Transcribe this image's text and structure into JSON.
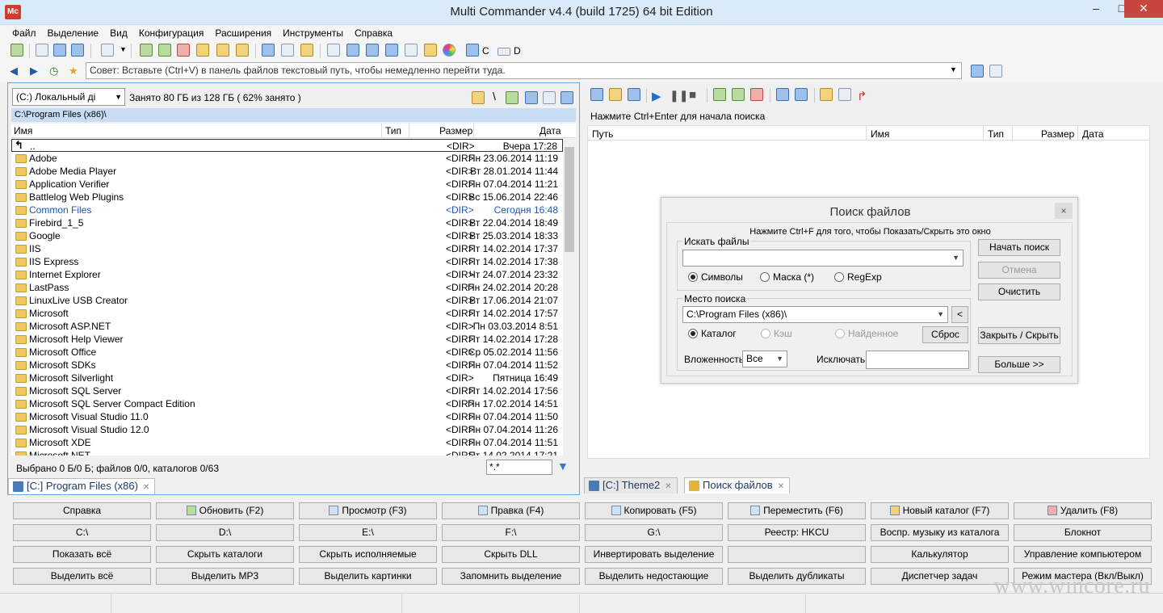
{
  "window": {
    "title": "Multi Commander v4.4 (build 1725) 64 bit Edition",
    "app_icon": "mc-logo-icon",
    "controls": [
      "–",
      "□",
      "✕"
    ]
  },
  "menu": [
    "Файл",
    "Выделение",
    "Вид",
    "Конфигурация",
    "Расширения",
    "Инструменты",
    "Справка"
  ],
  "toolbar": {
    "drive_c": "C",
    "drive_d": "D"
  },
  "address": {
    "placeholder": "Совет: Вставьте (Ctrl+V) в панель файлов текстовый путь, чтобы немедленно перейти туда."
  },
  "left_panel": {
    "drive": "(C:) Локальный ді",
    "drive_info": "Занято 80 ГБ из 128 ГБ ( 62% занято )",
    "path": "C:\\Program Files (x86)\\",
    "columns": {
      "name": "Имя",
      "type": "Тип",
      "size": "Размер",
      "date": "Дата"
    },
    "files": [
      {
        "name": "..",
        "size": "<DIR>",
        "date": "Вчера 17:28"
      },
      {
        "name": "Adobe",
        "size": "<DIR>",
        "date": "Пн 23.06.2014 11:19"
      },
      {
        "name": "Adobe Media Player",
        "size": "<DIR>",
        "date": "Вт 28.01.2014 11:44"
      },
      {
        "name": "Application Verifier",
        "size": "<DIR>",
        "date": "Пн 07.04.2014 11:21"
      },
      {
        "name": "Battlelog Web Plugins",
        "size": "<DIR>",
        "date": "Вс 15.06.2014 22:46"
      },
      {
        "name": "Common Files",
        "size": "<DIR>",
        "date": "Сегодня 16:48"
      },
      {
        "name": "Firebird_1_5",
        "size": "<DIR>",
        "date": "Вт 22.04.2014 18:49"
      },
      {
        "name": "Google",
        "size": "<DIR>",
        "date": "Вт 25.03.2014 18:33"
      },
      {
        "name": "IIS",
        "size": "<DIR>",
        "date": "Пт 14.02.2014 17:37"
      },
      {
        "name": "IIS Express",
        "size": "<DIR>",
        "date": "Пт 14.02.2014 17:38"
      },
      {
        "name": "Internet Explorer",
        "size": "<DIR>",
        "date": "Чт 24.07.2014 23:32"
      },
      {
        "name": "LastPass",
        "size": "<DIR>",
        "date": "Пн 24.02.2014 20:28"
      },
      {
        "name": "LinuxLive USB Creator",
        "size": "<DIR>",
        "date": "Вт 17.06.2014 21:07"
      },
      {
        "name": "Microsoft",
        "size": "<DIR>",
        "date": "Пт 14.02.2014 17:57"
      },
      {
        "name": "Microsoft ASP.NET",
        "size": "<DIR>",
        "date": "Пн 03.03.2014 8:51"
      },
      {
        "name": "Microsoft Help Viewer",
        "size": "<DIR>",
        "date": "Пт 14.02.2014 17:28"
      },
      {
        "name": "Microsoft Office",
        "size": "<DIR>",
        "date": "Ср 05.02.2014 11:56"
      },
      {
        "name": "Microsoft SDKs",
        "size": "<DIR>",
        "date": "Пн 07.04.2014 11:52"
      },
      {
        "name": "Microsoft Silverlight",
        "size": "<DIR>",
        "date": "Пятница 16:49"
      },
      {
        "name": "Microsoft SQL Server",
        "size": "<DIR>",
        "date": "Пт 14.02.2014 17:56"
      },
      {
        "name": "Microsoft SQL Server Compact Edition",
        "size": "<DIR>",
        "date": "Пн 17.02.2014 14:51"
      },
      {
        "name": "Microsoft Visual Studio 11.0",
        "size": "<DIR>",
        "date": "Пн 07.04.2014 11:50"
      },
      {
        "name": "Microsoft Visual Studio 12.0",
        "size": "<DIR>",
        "date": "Пн 07.04.2014 11:26"
      },
      {
        "name": "Microsoft XDE",
        "size": "<DIR>",
        "date": "Пн 07.04.2014 11:51"
      },
      {
        "name": "Microsoft.NET",
        "size": "<DIR>",
        "date": "Пт 14.02.2014 17:21"
      }
    ],
    "status": "Выбрано 0 Б/0 Б; файлов 0/0, каталогов 0/63",
    "filter": "*.*",
    "tab": "[C:] Program Files (x86)"
  },
  "right_panel": {
    "hint": "Нажмите Ctrl+Enter для начала поиска",
    "columns": {
      "path": "Путь",
      "name": "Имя",
      "type": "Тип",
      "size": "Размер",
      "date": "Дата"
    },
    "tabs": [
      "[C:] Theme2",
      "Поиск файлов"
    ]
  },
  "search_dialog": {
    "title": "Поиск файлов",
    "close": "×",
    "hint": "Нажмите Ctrl+F для того, чтобы Показать/Скрыть это окно",
    "search_files_label": "Искать файлы",
    "search_value": "",
    "modes": [
      "Символы",
      "Маска (*)",
      "RegExp"
    ],
    "location_label": "Место поиска",
    "location_value": "C:\\Program Files (x86)\\",
    "location_btn": "<",
    "scopes": [
      "Каталог",
      "Кэш",
      "Найденное"
    ],
    "reset": "Сброс",
    "depth_label": "Вложенность",
    "depth_value": "Все",
    "exclude_label": "Исключать",
    "exclude_value": "",
    "buttons": [
      "Начать поиск",
      "Отмена",
      "Очистить",
      "Закрыть / Скрыть",
      "Больше >>"
    ]
  },
  "function_keys": [
    [
      "Справка",
      "Обновить (F2)",
      "Просмотр (F3)",
      "Правка (F4)",
      "Копировать (F5)",
      "Переместить (F6)",
      "Новый каталог (F7)",
      "Удалить (F8)"
    ],
    [
      "C:\\",
      "D:\\",
      "E:\\",
      "F:\\",
      "G:\\",
      "Реестр: HKCU",
      "Воспр. музыку из каталога",
      "Блокнот"
    ],
    [
      "Показать всё",
      "Скрыть каталоги",
      "Скрыть исполняемые",
      "Скрыть DLL",
      "Инвертировать выделение",
      "",
      "Калькулятор",
      "Управление компьютером"
    ],
    [
      "Выделить всё",
      "Выделить MP3",
      "Выделить картинки",
      "Запомнить выделение",
      "Выделить недостающие",
      "Выделить дубликаты",
      "Диспетчер задач",
      "Режим мастера (Вкл/Выкл)"
    ]
  ],
  "watermark": "www.wincore.ru",
  "colors": {
    "accent": "#1d56b8",
    "path_bg": "#c8dcf3",
    "panel_border": "#6fa6dc"
  }
}
